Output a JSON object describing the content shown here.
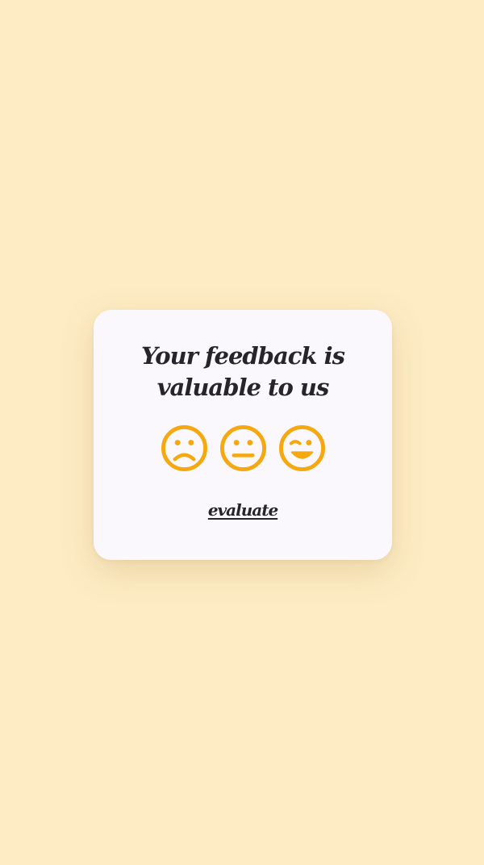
{
  "card": {
    "title": "Your feedback is valuable to us",
    "action_label": "evaluate"
  },
  "ratings": [
    {
      "icon": "sad-face-icon",
      "mood": "sad"
    },
    {
      "icon": "neutral-face-icon",
      "mood": "neutral"
    },
    {
      "icon": "winking-face-icon",
      "mood": "happy"
    }
  ],
  "colors": {
    "background": "#fdecc4",
    "card": "#fbf8fd",
    "text": "#26252c",
    "emoji": "#f5a80f"
  }
}
